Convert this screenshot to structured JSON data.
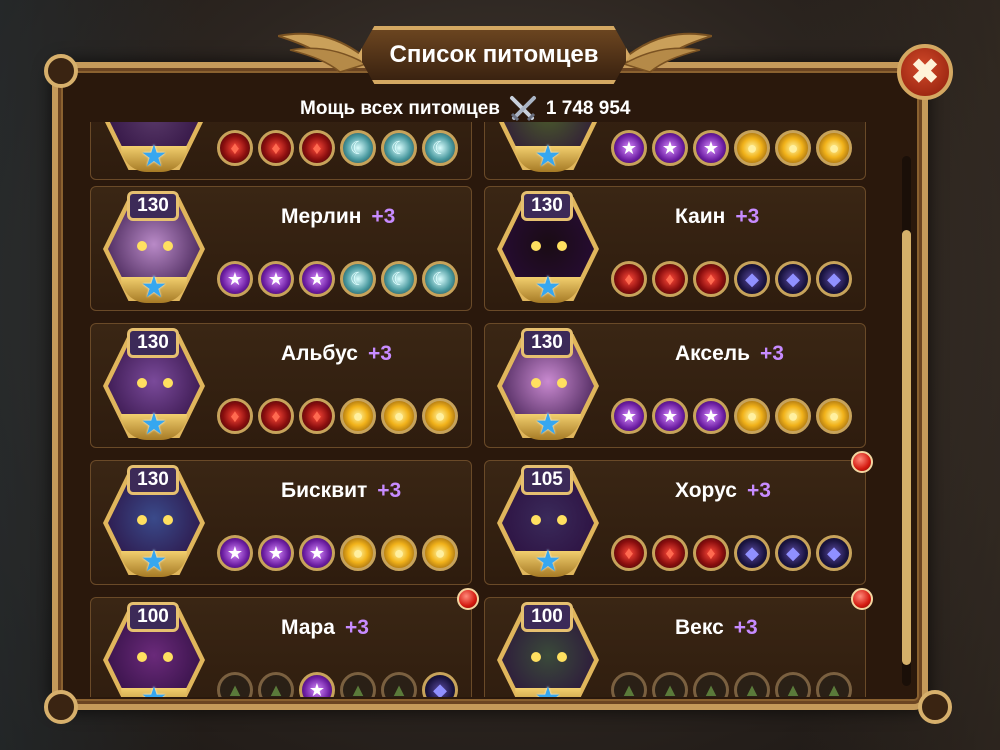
{
  "window": {
    "title": "Список питомцев",
    "close_symbol": "✖",
    "power_label": "Мощь всех питомцев",
    "power_value": "1 748 954"
  },
  "pets": [
    {
      "name": "",
      "plus": "",
      "level": "",
      "gems": [
        "red",
        "red",
        "red",
        "teal",
        "teal",
        "teal"
      ],
      "notify": false,
      "color": "#5a3a6a"
    },
    {
      "name": "",
      "plus": "",
      "level": "",
      "gems": [
        "purple",
        "purple",
        "purple",
        "gold",
        "gold",
        "gold"
      ],
      "notify": false,
      "color": "#4a5a2a"
    },
    {
      "name": "Мерлин",
      "plus": "+3",
      "level": "130",
      "gems": [
        "purple",
        "purple",
        "purple",
        "teal",
        "teal",
        "teal"
      ],
      "notify": false,
      "color": "#b98ac7"
    },
    {
      "name": "Каин",
      "plus": "+3",
      "level": "130",
      "gems": [
        "red",
        "red",
        "red",
        "dark",
        "dark",
        "dark"
      ],
      "notify": false,
      "color": "#1a0c14"
    },
    {
      "name": "Альбус",
      "plus": "+3",
      "level": "130",
      "gems": [
        "red",
        "red",
        "red",
        "gold",
        "gold",
        "gold"
      ],
      "notify": false,
      "color": "#7a4a9a"
    },
    {
      "name": "Аксель",
      "plus": "+3",
      "level": "130",
      "gems": [
        "purple",
        "purple",
        "purple",
        "gold",
        "gold",
        "gold"
      ],
      "notify": false,
      "color": "#c98ad0"
    },
    {
      "name": "Бисквит",
      "plus": "+3",
      "level": "130",
      "gems": [
        "purple",
        "purple",
        "purple",
        "gold",
        "gold",
        "gold"
      ],
      "notify": false,
      "color": "#3a4a8a"
    },
    {
      "name": "Хорус",
      "plus": "+3",
      "level": "105",
      "gems": [
        "red",
        "red",
        "red",
        "dark",
        "dark",
        "dark"
      ],
      "notify": true,
      "color": "#3a2a5a"
    },
    {
      "name": "Мара",
      "plus": "+3",
      "level": "100",
      "gems": [
        "empty",
        "empty",
        "purple",
        "empty",
        "empty",
        "dark"
      ],
      "notify": true,
      "color": "#6a2a7a"
    },
    {
      "name": "Векс",
      "plus": "+3",
      "level": "100",
      "gems": [
        "empty",
        "empty",
        "empty",
        "empty",
        "empty",
        "empty"
      ],
      "notify": true,
      "color": "#3a4a3a"
    }
  ],
  "gem_icons": {
    "red": "♦",
    "purple": "★",
    "gold": "●",
    "teal": "☾",
    "dark": "◆",
    "empty": "▲"
  },
  "star_icon": "★"
}
